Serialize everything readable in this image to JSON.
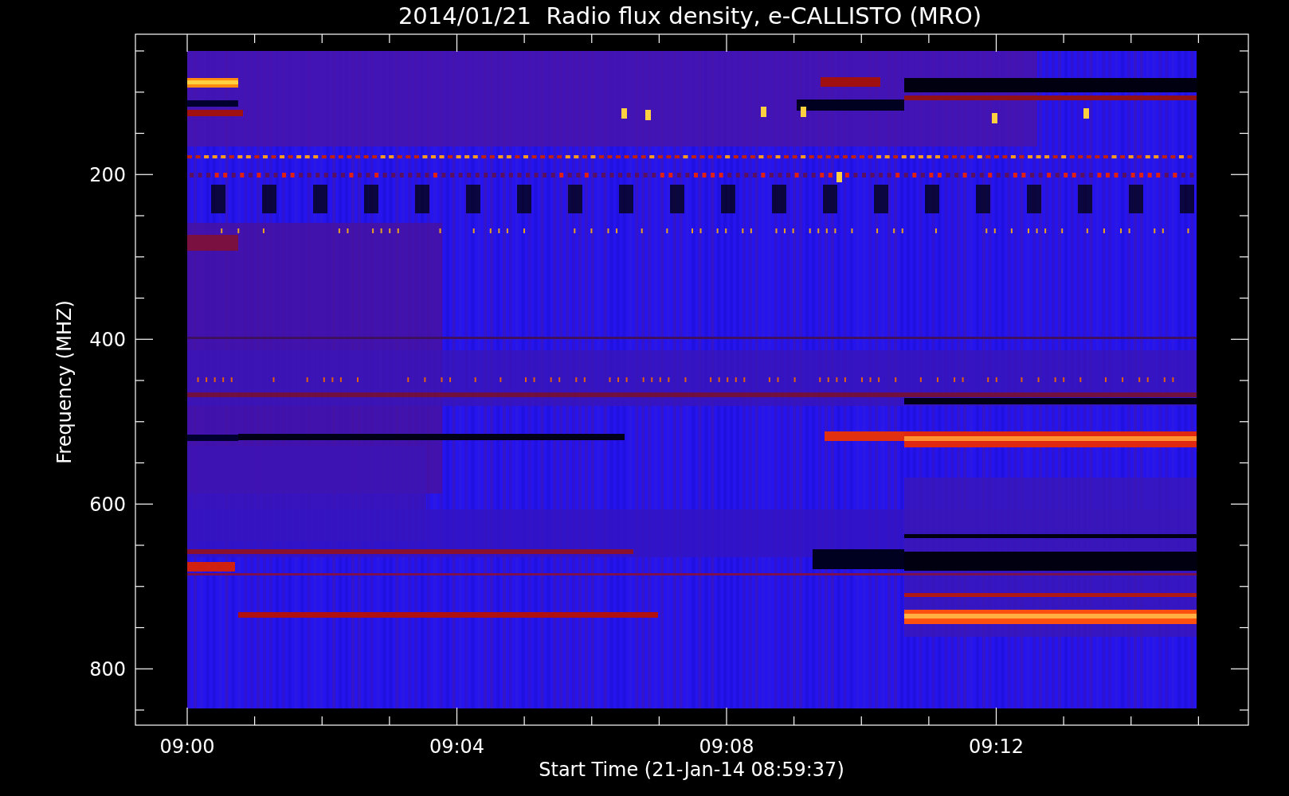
{
  "title": "2014/01/21  Radio flux density, e-CALLISTO (MRO)",
  "y_axis": {
    "label": "Frequency (MHZ)",
    "ticks": [
      "200",
      "400",
      "600",
      "800"
    ]
  },
  "x_axis": {
    "label": "Start Time (21-Jan-14 08:59:37)",
    "ticks": [
      "09:00",
      "09:04",
      "09:08",
      "09:12"
    ]
  }
}
